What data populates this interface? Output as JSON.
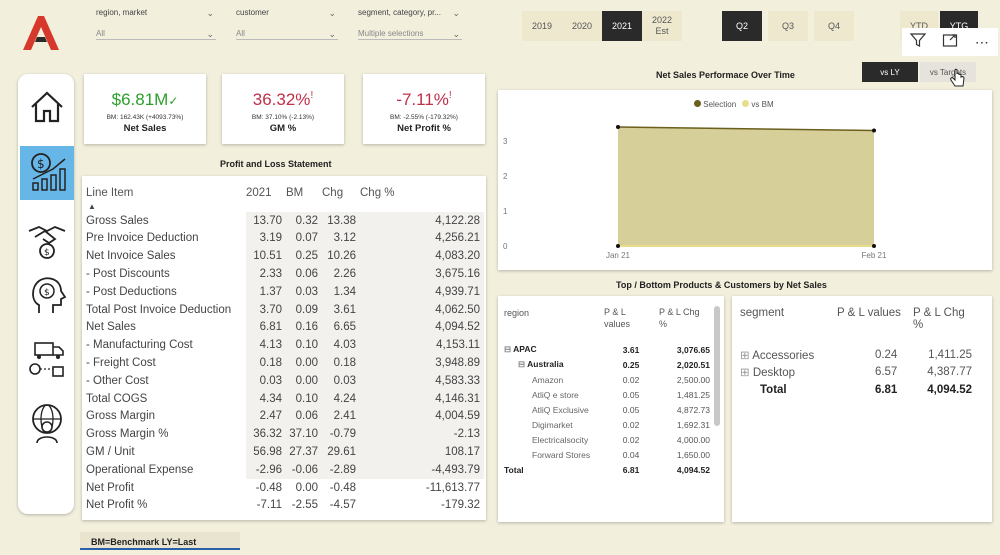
{
  "slicers": [
    {
      "label": "region, market",
      "value": "All"
    },
    {
      "label": "customer",
      "value": "All"
    },
    {
      "label": "segment, category, pr...",
      "value": "Multiple selections"
    }
  ],
  "years": [
    "2019",
    "2020",
    "2021",
    "2022 Est"
  ],
  "selected_year": "2021",
  "quarters": [
    "Q2",
    "Q3",
    "Q4"
  ],
  "selected_quarter": "Q2",
  "ytd": [
    "YTD",
    "YTG"
  ],
  "selected_ytd": "YTG",
  "kpis": [
    {
      "value": "$6.81M",
      "marker": "✓",
      "sub": "BM: 162.43K (+4093.73%)",
      "name": "Net Sales",
      "color": "#2ca02c"
    },
    {
      "value": "36.32%",
      "marker": "!",
      "sub": "BM: 37.10% (-2.13%)",
      "name": "GM %",
      "color": "#c0304a"
    },
    {
      "value": "-7.11%",
      "marker": "!",
      "sub": "BM: -2.55% (-179.32%)",
      "name": "Net Profit %",
      "color": "#c0304a"
    }
  ],
  "pl": {
    "title": "Profit and Loss Statement",
    "headers": [
      "Line Item",
      "2021",
      "BM",
      "Chg",
      "Chg %"
    ],
    "rows": [
      [
        "Gross Sales",
        "13.70",
        "0.32",
        "13.38",
        "4,122.28"
      ],
      [
        "Pre Invoice Deduction",
        "3.19",
        "0.07",
        "3.12",
        "4,256.21"
      ],
      [
        "Net Invoice Sales",
        "10.51",
        "0.25",
        "10.26",
        "4,083.20"
      ],
      [
        "- Post Discounts",
        "2.33",
        "0.06",
        "2.26",
        "3,675.16"
      ],
      [
        "- Post Deductions",
        "1.37",
        "0.03",
        "1.34",
        "4,939.71"
      ],
      [
        "Total Post Invoice Deduction",
        "3.70",
        "0.09",
        "3.61",
        "4,062.50"
      ],
      [
        "Net Sales",
        "6.81",
        "0.16",
        "6.65",
        "4,094.52"
      ],
      [
        "- Manufacturing Cost",
        "4.13",
        "0.10",
        "4.03",
        "4,153.11"
      ],
      [
        "- Freight Cost",
        "0.18",
        "0.00",
        "0.18",
        "3,948.89"
      ],
      [
        "- Other Cost",
        "0.03",
        "0.00",
        "0.03",
        "4,583.33"
      ],
      [
        "Total COGS",
        "4.34",
        "0.10",
        "4.24",
        "4,146.31"
      ],
      [
        "Gross Margin",
        "2.47",
        "0.06",
        "2.41",
        "4,004.59"
      ],
      [
        "Gross Margin %",
        "36.32",
        "37.10",
        "-0.79",
        "-2.13"
      ],
      [
        "GM / Unit",
        "56.98",
        "27.37",
        "29.61",
        "108.17"
      ],
      [
        "Operational Expense",
        "-2.96",
        "-0.06",
        "-2.89",
        "-4,493.79"
      ],
      [
        "Net Profit",
        "-0.48",
        "0.00",
        "-0.48",
        "-11,613.77"
      ],
      [
        "Net Profit %",
        "-7.11",
        "-2.55",
        "-4.57",
        "-179.32"
      ]
    ]
  },
  "trend": {
    "title": "Net Sales Performace Over Time",
    "toggle": [
      "vs LY",
      "vs Targets"
    ],
    "legend": [
      "Selection",
      "vs BM"
    ],
    "colors": {
      "selection": "#6b5f1e",
      "bm": "#e8dd8a",
      "area": "#d6cf9a"
    }
  },
  "chart_data": {
    "type": "area",
    "title": "Net Sales Performace Over Time",
    "categories": [
      "Jan 21",
      "Feb 21"
    ],
    "series": [
      {
        "name": "Selection",
        "values": [
          3.4,
          3.3
        ]
      },
      {
        "name": "vs BM",
        "values": [
          0,
          0
        ]
      }
    ],
    "yticks": [
      0,
      1,
      2,
      3
    ],
    "ylim": [
      0,
      3.6
    ],
    "legend": "top-center"
  },
  "topbottom": {
    "title": "Top / Bottom Products & Customers by Net Sales",
    "region_headers": [
      "region",
      "P & L values",
      "P & L Chg %"
    ],
    "region_rows": [
      {
        "label": "APAC",
        "v": "3.61",
        "c": "3,076.65",
        "level": 0,
        "bold": true
      },
      {
        "label": "Australia",
        "v": "0.25",
        "c": "2,020.51",
        "level": 1,
        "bold": true
      },
      {
        "label": "Amazon",
        "v": "0.02",
        "c": "2,500.00",
        "level": 2
      },
      {
        "label": "AtliQ e store",
        "v": "0.05",
        "c": "1,481.25",
        "level": 2
      },
      {
        "label": "AtliQ Exclusive",
        "v": "0.05",
        "c": "4,872.73",
        "level": 2
      },
      {
        "label": "Digimarket",
        "v": "0.02",
        "c": "1,692.31",
        "level": 2
      },
      {
        "label": "Electricalsocity",
        "v": "0.02",
        "c": "4,000.00",
        "level": 2
      },
      {
        "label": "Forward Stores",
        "v": "0.04",
        "c": "1,650.00",
        "level": 2
      },
      {
        "label": "Total",
        "v": "6.81",
        "c": "4,094.52",
        "level": 0,
        "bold": true
      }
    ],
    "segment_headers": [
      "segment",
      "P & L values",
      "P & L Chg %"
    ],
    "segment_rows": [
      {
        "label": "Accessories",
        "v": "0.24",
        "c": "1,411.25"
      },
      {
        "label": "Desktop",
        "v": "6.57",
        "c": "4,387.77"
      },
      {
        "label": "Total",
        "v": "6.81",
        "c": "4,094.52",
        "bold": true
      }
    ]
  },
  "footer": {
    "note": "BM=Benchmark  LY=Last"
  }
}
